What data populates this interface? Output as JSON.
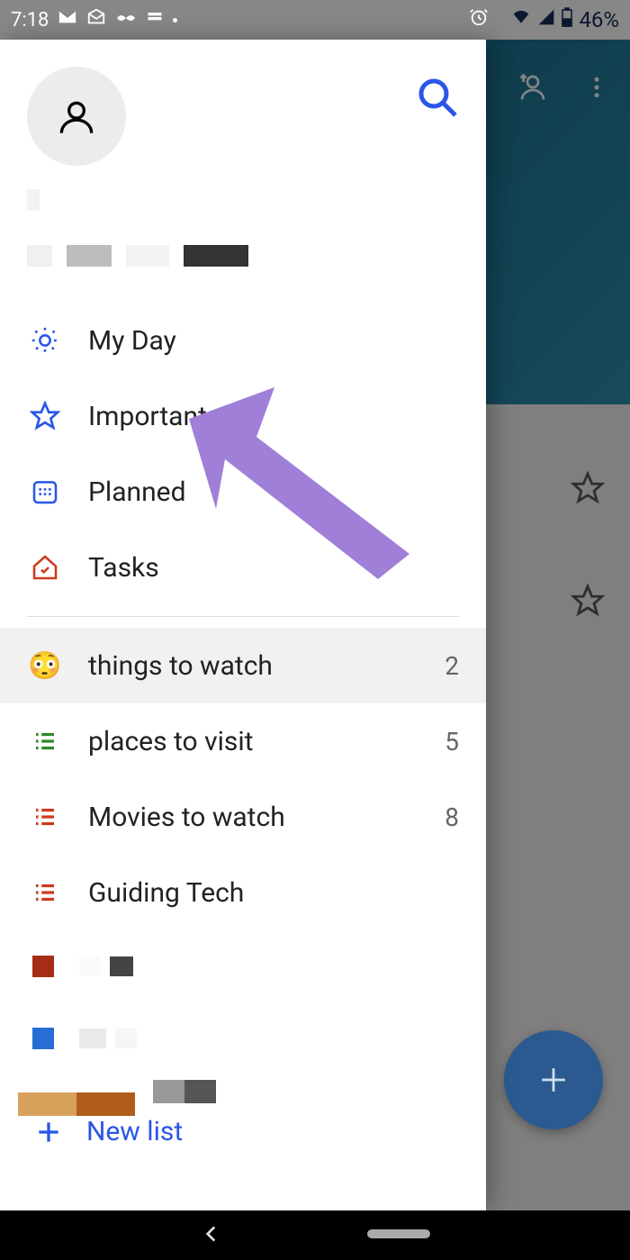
{
  "status": {
    "time": "7:18",
    "battery_label": "46%"
  },
  "drawer": {
    "smart_lists": [
      {
        "key": "myday",
        "label": "My Day"
      },
      {
        "key": "important",
        "label": "Important"
      },
      {
        "key": "planned",
        "label": "Planned"
      },
      {
        "key": "tasks",
        "label": "Tasks"
      }
    ],
    "user_lists": [
      {
        "icon": "emoji_flushed",
        "label": "things to watch",
        "count": "2",
        "active": true
      },
      {
        "icon": "list_green",
        "label": "places to visit",
        "count": "5"
      },
      {
        "icon": "list_red",
        "label": "Movies to watch",
        "count": "8"
      },
      {
        "icon": "list_red",
        "label": "Guiding Tech",
        "count": ""
      }
    ],
    "new_list_label": "New list"
  },
  "annotation": {
    "arrow_targets": "Important"
  }
}
